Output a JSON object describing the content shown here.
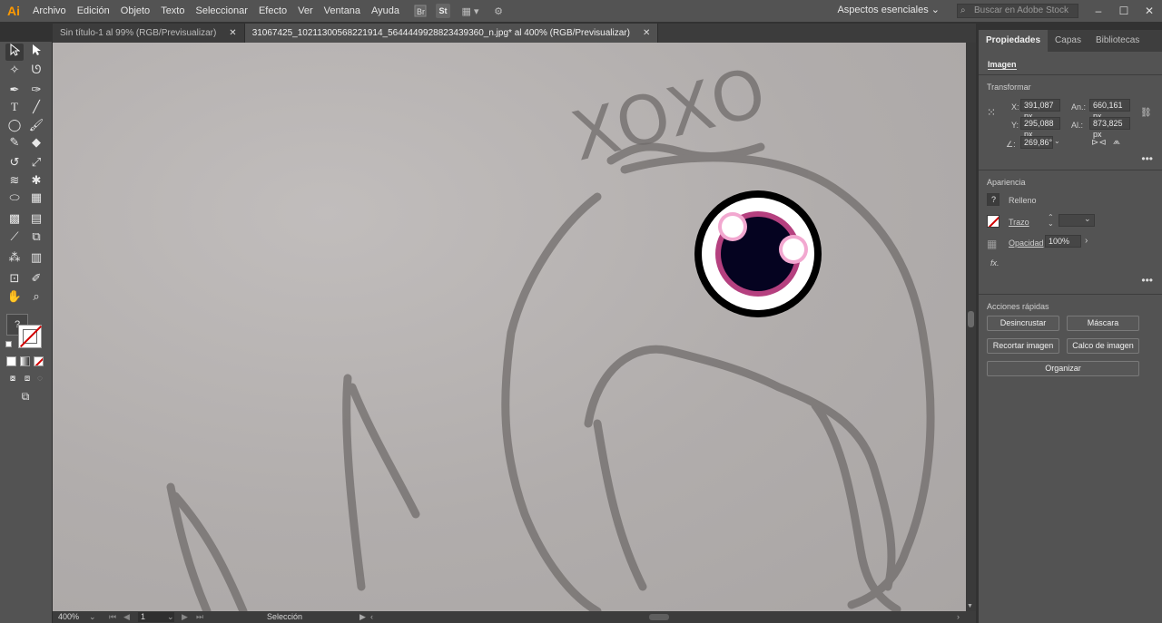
{
  "app": {
    "logo": "Ai"
  },
  "menu": [
    "Archivo",
    "Edición",
    "Objeto",
    "Texto",
    "Seleccionar",
    "Efecto",
    "Ver",
    "Ventana",
    "Ayuda"
  ],
  "menubar_icons": {
    "stock": "St",
    "arrange": "▦ ▾",
    "gpu": "⚙"
  },
  "workspace": "Aspectos esenciales ⌄",
  "stock_search": {
    "placeholder": "Buscar en Adobe Stock"
  },
  "window_controls": {
    "minimize": "–",
    "maximize": "☐",
    "close": "✕"
  },
  "tabs": [
    {
      "label": "Sin título-1 al 99% (RGB/Previsualizar)",
      "close": "✕"
    },
    {
      "label": "31067425_10211300568221914_5644449928823439360_n.jpg* al 400% (RGB/Previsualizar)",
      "close": "✕"
    }
  ],
  "canvas": {
    "sketch_text": "XOXO",
    "colors": {
      "eye_outer": "#000000",
      "eye_white": "#ffffff",
      "eye_ring": "#b5407f",
      "eye_pupil": "#050320",
      "highlight_ring": "#f2a8d0"
    }
  },
  "status": {
    "zoom": "400%",
    "artboard": "1",
    "tool": "Selección"
  },
  "panel": {
    "tabs": [
      "Propiedades",
      "Capas",
      "Bibliotecas"
    ],
    "object_type": "Imagen",
    "transform": {
      "title": "Transformar",
      "x_label": "X:",
      "x_value": "391,087 px",
      "y_label": "Y:",
      "y_value": "295,088 px",
      "w_label": "An.:",
      "w_value": "660,161 px",
      "h_label": "Al.:",
      "h_value": "873,825 px",
      "angle_label": "∠:",
      "angle_value": "269,86°"
    },
    "appearance": {
      "title": "Apariencia",
      "fill_label": "Relleno",
      "stroke_label": "Trazo",
      "opacity_label": "Opacidad",
      "opacity_value": "100%",
      "fx": "fx."
    },
    "quick_actions": {
      "title": "Acciones rápidas",
      "embed": "Desincrustar",
      "mask": "Máscara",
      "crop": "Recortar imagen",
      "trace": "Calco de imagen",
      "arrange": "Organizar"
    },
    "more": "•••"
  }
}
